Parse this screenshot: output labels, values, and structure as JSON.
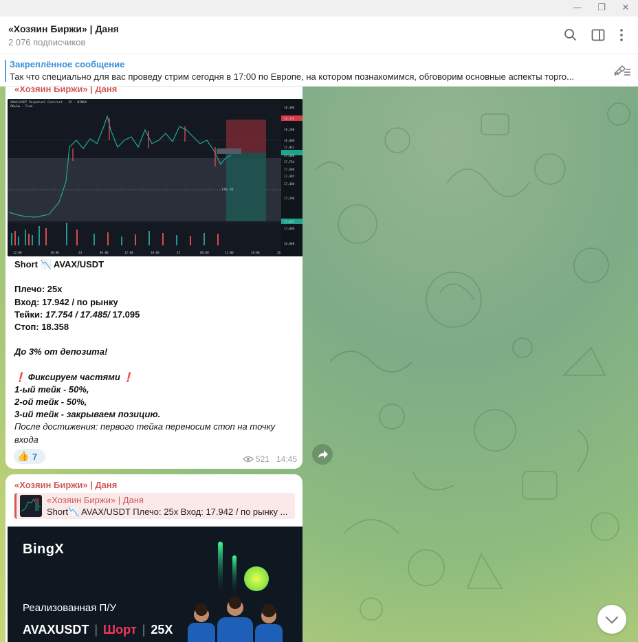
{
  "window": {
    "minimize_glyph": "—",
    "restore_glyph": "❐",
    "close_glyph": "✕"
  },
  "header": {
    "title": "«Хозяин Биржи» | Даня",
    "subscribers": "2 076 подписчиков",
    "icons": [
      "search-icon",
      "sidebar-toggle-icon",
      "more-vertical-icon"
    ]
  },
  "pinned": {
    "title": "Закреплённое сообщение",
    "text": "Так что специально для вас проведу стрим сегодня в 17:00 по Европе, на котором познакомимся, обговорим основные аспекты торго..."
  },
  "message1": {
    "sender": "«Хозяин Биржи» | Даня",
    "lines": {
      "l1_a": "Short",
      "l1_emoji": "📉",
      "l1_b": "AVAX/USDT",
      "l2": "Плечо: 25x",
      "l3": "Вход: 17.942 / по рынку",
      "l4_a": "Тейки: ",
      "l4_b": "17.754 / 17.485/",
      "l4_c": " 17.095",
      "l5": "Стоп: 18.358",
      "l6": "До 3% от депозита!",
      "l7_mark": "❗",
      "l7": " Фиксируем частями ",
      "l8": "1-ый тейк - 50%,",
      "l9": "2-ой тейк - 50%,",
      "l10": "3-ий тейк - закрываем позицию.",
      "l11": "После достижения: первого тейка переносим стоп на точку",
      "l12": "входа"
    },
    "reaction": {
      "emoji": "👍",
      "count": "7"
    },
    "views": "521",
    "time": "14:45",
    "chart_labels": {
      "prices": [
        "18,400",
        "18,358",
        "18,200",
        "18,000",
        "17,942",
        "17,800",
        "17,754",
        "17,600",
        "17,485",
        "17,400",
        "17,200",
        "17,095",
        "17,000",
        "16,800"
      ],
      "times": [
        "12:00",
        "18:00",
        "24",
        "06:00",
        "12:00",
        "18:00",
        "25",
        "06:00",
        "12:00",
        "18:00",
        "26"
      ],
      "fvg": "FVG 1D"
    }
  },
  "message2": {
    "sender": "«Хозяин Биржи» | Даня",
    "reply_name": "«Хозяин Биржи» | Даня",
    "reply_text": "Short📉 AVAX/USDT  Плечо: 25x Вход: 17.942 / по рынку ...",
    "banner": {
      "logo": "BingX",
      "pnl_label": "Реализованная П/У",
      "pair": "AVAXUSDT",
      "side": "Шорт",
      "leverage": "25X"
    }
  },
  "colors": {
    "accent": "#3a8fd6",
    "sender": "#d25656",
    "short": "#f2385a",
    "chart_bg": "#141820"
  }
}
